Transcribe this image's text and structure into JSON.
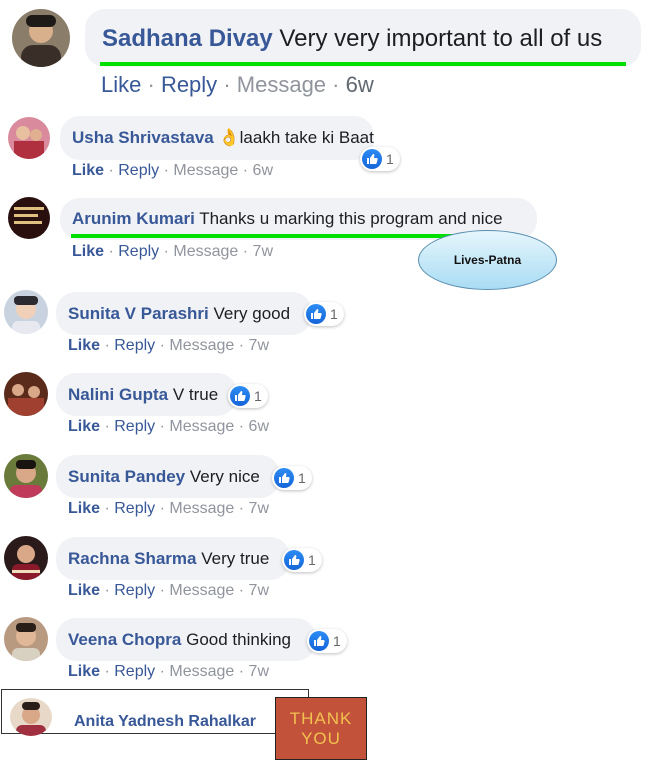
{
  "comments": [
    {
      "name": "Sadhana Divay",
      "text": "Very very important to all of us",
      "time": "6w",
      "reactions": ""
    },
    {
      "name": "Usha Shrivastava",
      "emoji": "👌",
      "text": "laakh take ki Baat",
      "time": "6w",
      "reactions": "1"
    },
    {
      "name": "Arunim Kumari",
      "text": "Thanks u marking this program and nice",
      "time": "7w",
      "reactions": ""
    },
    {
      "name": "Sunita V Parashri",
      "text": "Very good",
      "time": "7w",
      "reactions": "1"
    },
    {
      "name": "Nalini Gupta",
      "text": "V true",
      "time": "6w",
      "reactions": "1"
    },
    {
      "name": "Sunita Pandey",
      "text": "Very nice",
      "time": "7w",
      "reactions": "1"
    },
    {
      "name": "Rachna Sharma",
      "text": "Very true",
      "time": "7w",
      "reactions": "1"
    },
    {
      "name": "Veena Chopra",
      "text": "Good thinking",
      "time": "7w",
      "reactions": "1"
    }
  ],
  "actions": {
    "like": "Like",
    "reply": "Reply",
    "message": "Message",
    "sep": "·"
  },
  "callout": {
    "label": "Lives-Patna"
  },
  "footer": {
    "name": "Anita Yadnesh Rahalkar",
    "badge_line1": "THANK",
    "badge_line2": "YOU"
  },
  "colors": {
    "name_blue": "#385898",
    "highlight_green": "#00e000",
    "callout_fill": "#bfe6f7",
    "badge_bg": "#c2533a",
    "badge_text": "#f2c14e"
  }
}
